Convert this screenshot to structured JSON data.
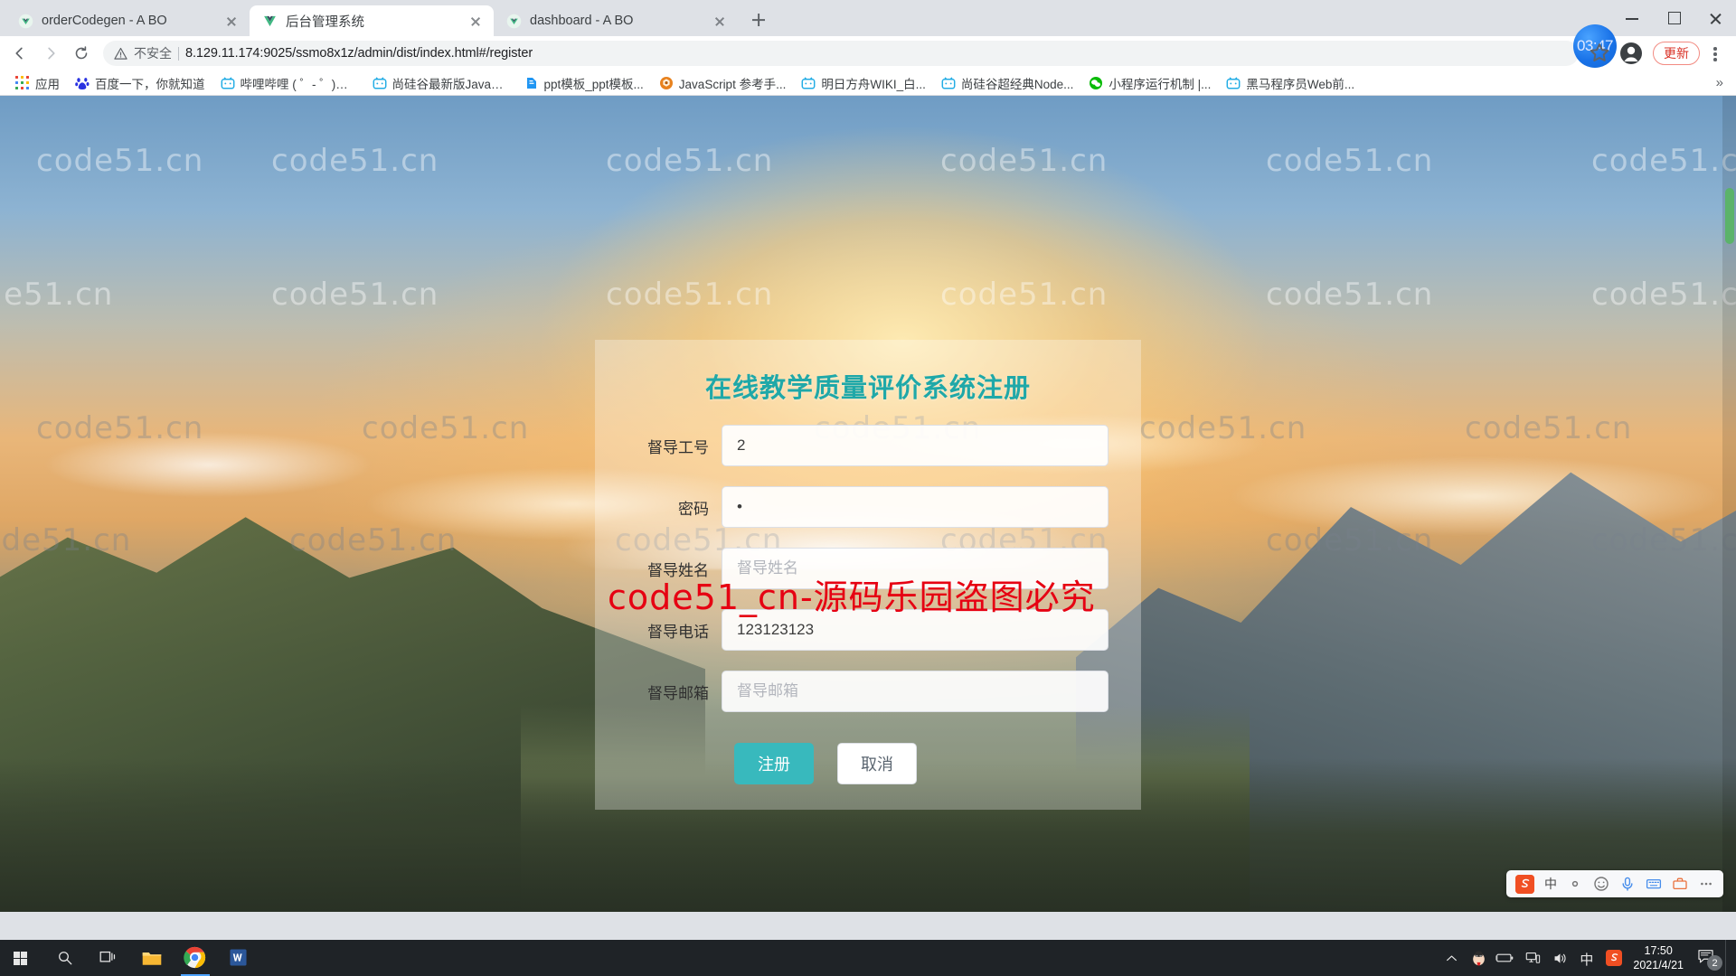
{
  "browser": {
    "tabs": [
      {
        "title": "orderCodegen - A BO",
        "favicon": "vue-icon",
        "active": false
      },
      {
        "title": "后台管理系统",
        "favicon": "vue-icon",
        "active": true
      },
      {
        "title": "dashboard - A BO",
        "favicon": "vue-icon",
        "active": false
      }
    ],
    "new_tab_label": "+",
    "window_controls": {
      "minimize": "minimize-icon",
      "maximize": "maximize-icon",
      "close": "close-icon"
    },
    "toolbar": {
      "back": "back-arrow-icon",
      "forward": "forward-arrow-icon",
      "reload": "reload-icon",
      "security_icon": "warning-triangle-icon",
      "security_text": "不安全",
      "url": "8.129.11.174:9025/ssmo8x1z/admin/dist/index.html#/register",
      "clock_badge": "03:47",
      "bookmark_star": "star-icon",
      "profile": "account-avatar-icon",
      "update_label": "更新",
      "menu": "kebab-menu-icon"
    },
    "bookmarks": {
      "items": [
        {
          "label": "应用",
          "icon": "apps-grid-icon"
        },
        {
          "label": "百度一下，你就知道",
          "icon": "baidu-icon"
        },
        {
          "label": "哔哩哔哩 ( ゜- ゜)つ...",
          "icon": "bilibili-icon"
        },
        {
          "label": "尚硅谷最新版JavaS...",
          "icon": "bilibili-icon"
        },
        {
          "label": "ppt模板_ppt模板...",
          "icon": "ppt-icon"
        },
        {
          "label": "JavaScript 参考手...",
          "icon": "mdn-icon"
        },
        {
          "label": "明日方舟WIKI_白...",
          "icon": "bilibili-icon"
        },
        {
          "label": "尚硅谷超经典Node...",
          "icon": "bilibili-icon"
        },
        {
          "label": "小程序运行机制 |...",
          "icon": "wechat-icon"
        },
        {
          "label": "黑马程序员Web前...",
          "icon": "bilibili-icon"
        }
      ],
      "overflow": "»"
    }
  },
  "page": {
    "title": "在线教学质量评价系统注册",
    "title_color": "#1fa8a8",
    "fields": [
      {
        "label": "督导工号",
        "value": "2",
        "placeholder": "督导工号",
        "type": "text",
        "name": "supervisor-id"
      },
      {
        "label": "密码",
        "value": "1",
        "placeholder": "密码",
        "type": "password",
        "name": "password"
      },
      {
        "label": "督导姓名",
        "value": "",
        "placeholder": "督导姓名",
        "type": "text",
        "name": "supervisor-name"
      },
      {
        "label": "督导电话",
        "value": "123123123",
        "placeholder": "督导电话",
        "type": "text",
        "name": "supervisor-phone"
      },
      {
        "label": "督导邮箱",
        "value": "",
        "placeholder": "督导邮箱",
        "type": "text",
        "name": "supervisor-email"
      }
    ],
    "buttons": {
      "register": "注册",
      "cancel": "取消"
    },
    "watermark_text": "code51.cn",
    "watermark_red": "code51_cn-源码乐园盗图必究",
    "accent_color": "#38b9bd"
  },
  "ime": {
    "lang": "中",
    "items": [
      "sogou-logo",
      "中",
      "dot-icon",
      "smiley-icon",
      "mic-icon",
      "keyboard-icon",
      "toolbox-icon",
      "more-icon"
    ]
  },
  "taskbar": {
    "start": "windows-start-icon",
    "search": "search-icon",
    "taskview": "task-view-icon",
    "apps": [
      {
        "name": "file-explorer-icon"
      },
      {
        "name": "google-chrome-icon"
      },
      {
        "name": "microsoft-word-icon"
      }
    ],
    "tray": {
      "chevron": "show-hidden-icons-icon",
      "icons": [
        "qq-icon",
        "battery-icon",
        "network-icon",
        "volume-icon",
        "ime-chinese-icon",
        "sogou-icon"
      ],
      "ime_label": "中",
      "time": "17:50",
      "date": "2021/4/21",
      "notification_count": "2"
    }
  }
}
